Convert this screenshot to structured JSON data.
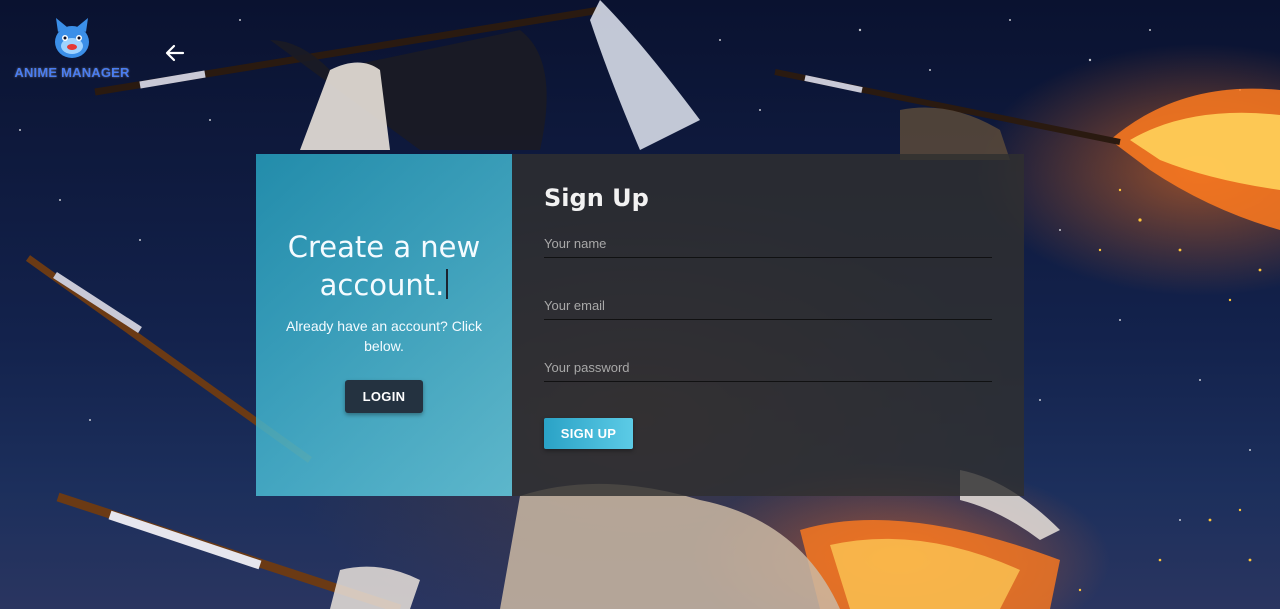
{
  "app": {
    "logo_text": "ANIME MANAGER",
    "logo_icon": "blue-mascot-icon",
    "back_icon": "arrow-left-icon"
  },
  "promo": {
    "title": "Create a new account.",
    "subtitle": "Already have an account? Click below.",
    "login_label": "LOGIN"
  },
  "signup": {
    "title": "Sign Up",
    "name_placeholder": "Your name",
    "name_value": "",
    "email_placeholder": "Your email",
    "email_value": "",
    "password_placeholder": "Your password",
    "password_value": "",
    "submit_label": "SIGN UP"
  },
  "colors": {
    "accent": "#2aa2c6",
    "accent_light": "#5ccbe6",
    "login_button": "#243240",
    "panel_dark": "#303030",
    "logo_blue": "#4a7df0"
  }
}
